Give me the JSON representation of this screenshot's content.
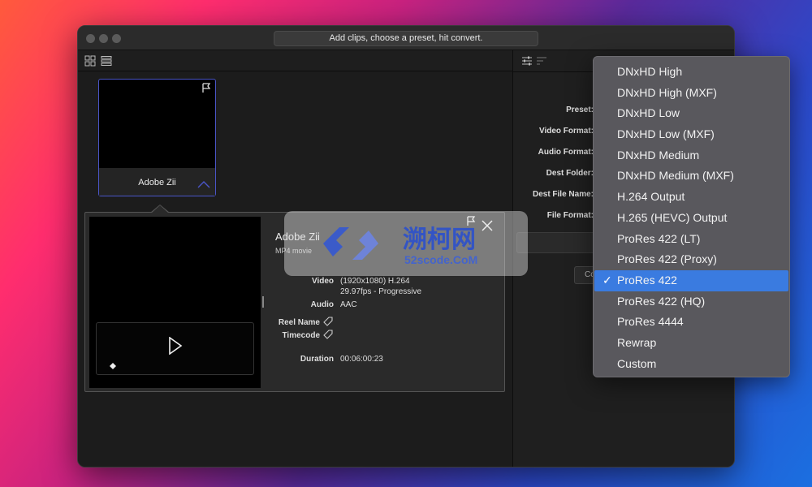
{
  "window": {
    "title_hint": "Add clips, choose a preset, hit convert."
  },
  "clip": {
    "name": "Adobe Zii"
  },
  "info": {
    "title": "Adobe Zii",
    "subtitle": "MP4 movie",
    "video_key": "Video",
    "video_val1": "(1920x1080) H.264",
    "video_val2": "29.97fps - Progressive",
    "audio_key": "Audio",
    "audio_val": "AAC",
    "reel_key": "Reel Name",
    "timecode_key": "Timecode",
    "duration_key": "Duration",
    "duration_val": "00:06:00:23"
  },
  "settings": {
    "preset": "Preset:",
    "video_format": "Video Format:",
    "audio_format": "Audio Format:",
    "dest_folder": "Dest Folder:",
    "dest_file_name": "Dest File Name:",
    "file_format": "File Format:",
    "a_button": "A",
    "co_button": "Co"
  },
  "watermark": {
    "cn": "溯柯网",
    "url": "52scode.CoM"
  },
  "menu": {
    "items": [
      "DNxHD High",
      "DNxHD High (MXF)",
      "DNxHD Low",
      "DNxHD Low (MXF)",
      "DNxHD Medium",
      "DNxHD Medium (MXF)",
      "H.264 Output",
      "H.265 (HEVC) Output",
      "ProRes 422 (LT)",
      "ProRes 422 (Proxy)",
      "ProRes 422",
      "ProRes 422 (HQ)",
      "ProRes 4444",
      "Rewrap",
      "Custom"
    ],
    "selected": "ProRes 422",
    "check": "✓"
  },
  "colors": {
    "selection": "#3a7be0",
    "clip_border": "#4a55c8"
  }
}
